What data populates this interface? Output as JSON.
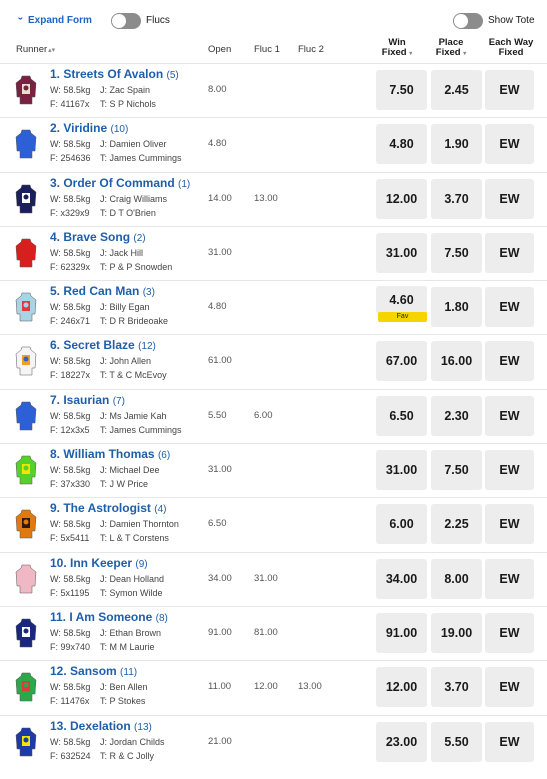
{
  "controls": {
    "expand_form": "Expand Form",
    "flucs": "Flucs",
    "show_tote": "Show Tote"
  },
  "columns": {
    "runner": "Runner",
    "open": "Open",
    "fluc1": "Fluc 1",
    "fluc2": "Fluc 2",
    "win_fixed_1": "Win",
    "win_fixed_2": "Fixed",
    "place_fixed_1": "Place",
    "place_fixed_2": "Fixed",
    "ew_1": "Each Way",
    "ew_2": "Fixed"
  },
  "runners": [
    {
      "name": "1. Streets Of Avalon",
      "barrier": "(5)",
      "weight": "W: 58.5kg",
      "jockey": "J: Zac Spain",
      "form": "F: 41167x",
      "trainer": "T: S P Nichols",
      "open": "8.00",
      "fluc1": "",
      "fluc2": "",
      "win": "7.50",
      "place": "2.45",
      "ew": "EW",
      "fav": "",
      "silk": [
        "#7a2040",
        "#e8e0cc",
        "#7a2040"
      ]
    },
    {
      "name": "2. Viridine",
      "barrier": "(10)",
      "weight": "W: 58.5kg",
      "jockey": "J: Damien Oliver",
      "form": "F: 254636",
      "trainer": "T: James Cummings",
      "open": "4.80",
      "fluc1": "",
      "fluc2": "",
      "win": "4.80",
      "place": "1.90",
      "ew": "EW",
      "fav": "",
      "silk": [
        "#2d5fd6",
        "#2d5fd6",
        "#2d5fd6"
      ]
    },
    {
      "name": "3. Order Of Command",
      "barrier": "(1)",
      "weight": "W: 58.5kg",
      "jockey": "J: Craig Williams",
      "form": "F: x329x9",
      "trainer": "T: D T O'Brien",
      "open": "14.00",
      "fluc1": "13.00",
      "fluc2": "",
      "win": "12.00",
      "place": "3.70",
      "ew": "EW",
      "fav": "",
      "silk": [
        "#1b1f5e",
        "#ffffff",
        "#1b1f5e"
      ]
    },
    {
      "name": "4. Brave Song",
      "barrier": "(2)",
      "weight": "W: 58.5kg",
      "jockey": "J: Jack Hill",
      "form": "F: 62329x",
      "trainer": "T: P & P Snowden",
      "open": "31.00",
      "fluc1": "",
      "fluc2": "",
      "win": "31.00",
      "place": "7.50",
      "ew": "EW",
      "fav": "",
      "silk": [
        "#d91e1e",
        "#d91e1e",
        "#d91e1e"
      ]
    },
    {
      "name": "5. Red Can Man",
      "barrier": "(3)",
      "weight": "W: 58.5kg",
      "jockey": "J: Billy Egan",
      "form": "F: 246x71",
      "trainer": "T: D R Brideoake",
      "open": "4.80",
      "fluc1": "",
      "fluc2": "",
      "win": "4.60",
      "place": "1.80",
      "ew": "EW",
      "fav": "Fav",
      "silk": [
        "#a8d4e6",
        "#e23a3a",
        "#a8d4e6"
      ]
    },
    {
      "name": "6. Secret Blaze",
      "barrier": "(12)",
      "weight": "W: 58.5kg",
      "jockey": "J: John Allen",
      "form": "F: 18227x",
      "trainer": "T: T & C McEvoy",
      "open": "61.00",
      "fluc1": "",
      "fluc2": "",
      "win": "67.00",
      "place": "16.00",
      "ew": "EW",
      "fav": "",
      "silk": [
        "#f5f5f5",
        "#f0a020",
        "#2d5fd6"
      ]
    },
    {
      "name": "7. Isaurian",
      "barrier": "(7)",
      "weight": "W: 58.5kg",
      "jockey": "J: Ms Jamie Kah",
      "form": "F: 12x3x5",
      "trainer": "T: James Cummings",
      "open": "5.50",
      "fluc1": "6.00",
      "fluc2": "",
      "win": "6.50",
      "place": "2.30",
      "ew": "EW",
      "fav": "",
      "silk": [
        "#2d5fd6",
        "#2d5fd6",
        "#2d5fd6"
      ]
    },
    {
      "name": "8. William Thomas",
      "barrier": "(6)",
      "weight": "W: 58.5kg",
      "jockey": "J: Michael Dee",
      "form": "F: 37x330",
      "trainer": "T: J W Price",
      "open": "31.00",
      "fluc1": "",
      "fluc2": "",
      "win": "31.00",
      "place": "7.50",
      "ew": "EW",
      "fav": "",
      "silk": [
        "#55d12a",
        "#f2e600",
        "#55d12a"
      ]
    },
    {
      "name": "9. The Astrologist",
      "barrier": "(4)",
      "weight": "W: 58.5kg",
      "jockey": "J: Damien Thornton",
      "form": "F: 5x5411",
      "trainer": "T: L & T Corstens",
      "open": "6.50",
      "fluc1": "",
      "fluc2": "",
      "win": "6.00",
      "place": "2.25",
      "ew": "EW",
      "fav": "",
      "silk": [
        "#e07a10",
        "#2a1a10",
        "#e07a10"
      ]
    },
    {
      "name": "10. Inn Keeper",
      "barrier": "(9)",
      "weight": "W: 58.5kg",
      "jockey": "J: Dean Holland",
      "form": "F: 5x1195",
      "trainer": "T: Symon Wilde",
      "open": "34.00",
      "fluc1": "31.00",
      "fluc2": "",
      "win": "34.00",
      "place": "8.00",
      "ew": "EW",
      "fav": "",
      "silk": [
        "#f0b8c4",
        "#f0b8c4",
        "#f0b8c4"
      ]
    },
    {
      "name": "11. I Am Someone",
      "barrier": "(8)",
      "weight": "W: 58.5kg",
      "jockey": "J: Ethan Brown",
      "form": "F: 99x740",
      "trainer": "T: M M Laurie",
      "open": "91.00",
      "fluc1": "81.00",
      "fluc2": "",
      "win": "91.00",
      "place": "19.00",
      "ew": "EW",
      "fav": "",
      "silk": [
        "#1a2680",
        "#ffffff",
        "#1a2680"
      ]
    },
    {
      "name": "12. Sansom",
      "barrier": "(11)",
      "weight": "W: 58.5kg",
      "jockey": "J: Ben Allen",
      "form": "F: 11476x",
      "trainer": "T: P Stokes",
      "open": "11.00",
      "fluc1": "12.00",
      "fluc2": "13.00",
      "win": "12.00",
      "place": "3.70",
      "ew": "EW",
      "fav": "",
      "silk": [
        "#2aa84a",
        "#e23a3a",
        "#2aa84a"
      ]
    },
    {
      "name": "13. Dexelation",
      "barrier": "(13)",
      "weight": "W: 58.5kg",
      "jockey": "J: Jordan Childs",
      "form": "F: 632524",
      "trainer": "T: R & C Jolly",
      "open": "21.00",
      "fluc1": "",
      "fluc2": "",
      "win": "23.00",
      "place": "5.50",
      "ew": "EW",
      "fav": "",
      "silk": [
        "#1c3aa8",
        "#f2e600",
        "#1c3aa8"
      ]
    }
  ]
}
